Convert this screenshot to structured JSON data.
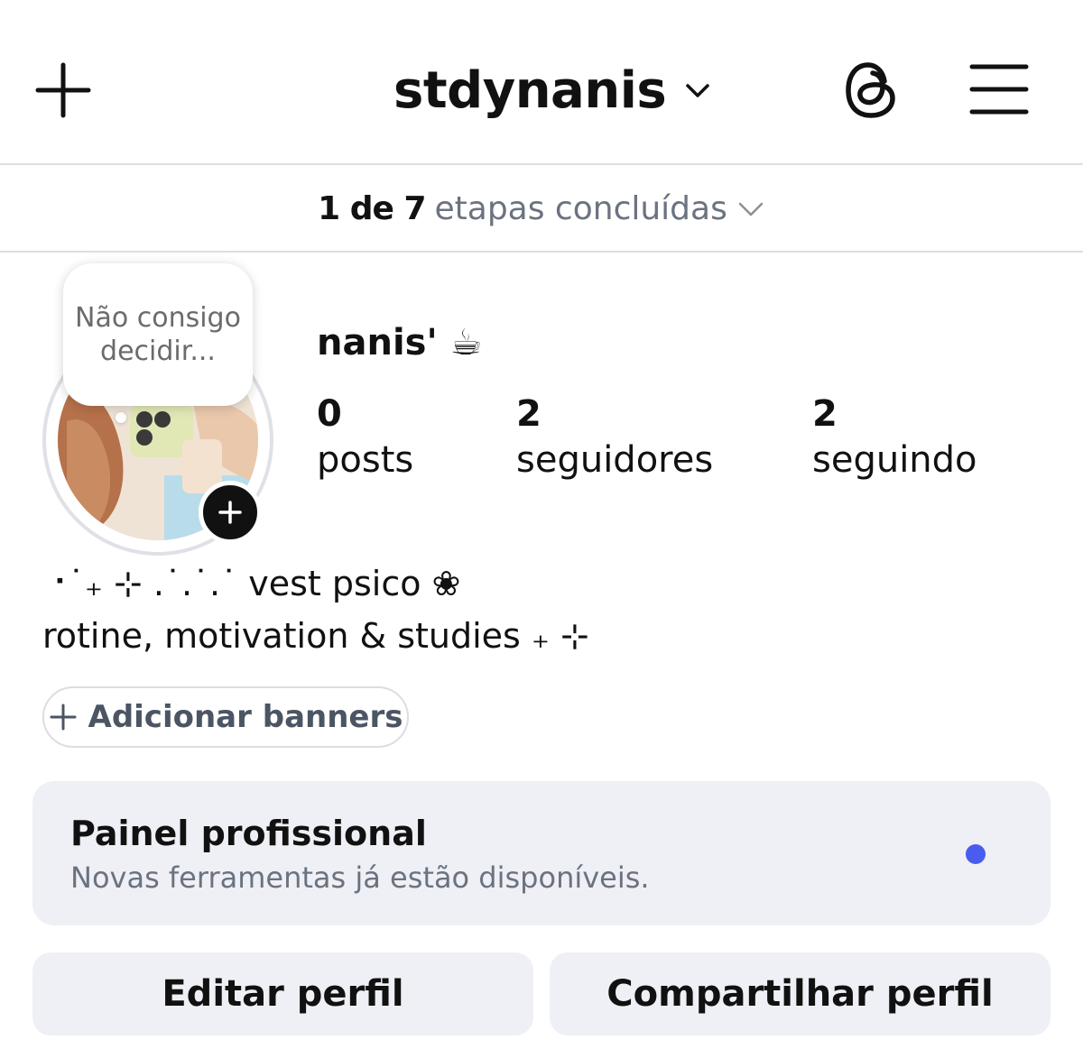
{
  "header": {
    "username": "stdynanis",
    "create_icon": "plus-icon",
    "account_switch_icon": "chevron-down-icon",
    "threads_icon": "threads-icon",
    "menu_icon": "hamburger-menu-icon"
  },
  "steps": {
    "count": "1 de 7",
    "label": "etapas concluídas",
    "icon": "chevron-down-icon"
  },
  "profile": {
    "note": "Não consigo decidir...",
    "avatar_alt": "profile photo",
    "add_story_icon": "plus-icon",
    "display_name": "nanis' ☕",
    "stats": [
      {
        "value": "0",
        "label": "posts"
      },
      {
        "value": "2",
        "label": "seguidores"
      },
      {
        "value": "2",
        "label": "seguindo"
      }
    ],
    "bio": [
      "⠐˙₊ ⊹ .˙.˙.˙ vest psico ❀",
      "rotine, motivation & studies ₊ ⊹"
    ],
    "add_banners_label": "Adicionar banners"
  },
  "professional_panel": {
    "title": "Painel profissional",
    "subtitle": "Novas ferramentas já estão disponíveis.",
    "dot_color": "#4a5cf0"
  },
  "actions": {
    "edit_label": "Editar perfil",
    "share_label": "Compartilhar perfil"
  }
}
